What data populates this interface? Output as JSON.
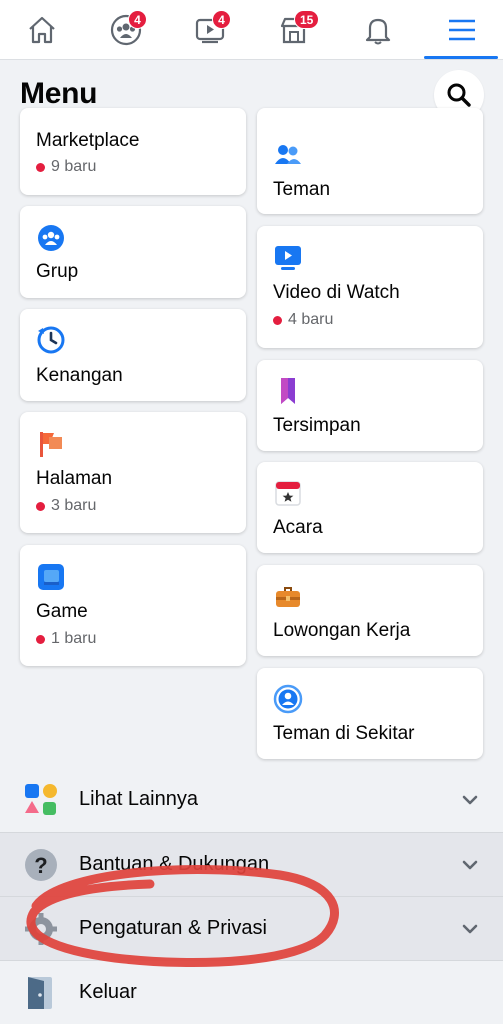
{
  "tabs": [
    {
      "name": "home-tab",
      "icon": "home-icon"
    },
    {
      "name": "groups-tab",
      "icon": "groups-icon",
      "badge": "4"
    },
    {
      "name": "watch-tab",
      "icon": "watch-icon",
      "badge": "4"
    },
    {
      "name": "marketplace-tab",
      "icon": "marketplace-icon",
      "badge": "15"
    },
    {
      "name": "notifications-tab",
      "icon": "bell-icon"
    },
    {
      "name": "menu-tab",
      "icon": "hamburger-icon",
      "active": true
    }
  ],
  "header": {
    "title": "Menu",
    "search_icon": "search-icon"
  },
  "left_cards": [
    {
      "label": "Marketplace",
      "sub": "9 baru",
      "icon": "marketplace-icon"
    },
    {
      "label": "Grup",
      "icon": "groups-icon"
    },
    {
      "label": "Kenangan",
      "icon": "memories-icon"
    },
    {
      "label": "Halaman",
      "sub": "3 baru",
      "icon": "pages-flag-icon"
    },
    {
      "label": "Game",
      "sub": "1 baru",
      "icon": "game-icon"
    }
  ],
  "right_cards": [
    {
      "label": "Teman",
      "icon": "friends-icon"
    },
    {
      "label": "Video di Watch",
      "sub": "4 baru",
      "icon": "watch-video-icon"
    },
    {
      "label": "Tersimpan",
      "icon": "bookmark-icon"
    },
    {
      "label": "Acara",
      "icon": "calendar-icon"
    },
    {
      "label": "Lowongan Kerja",
      "icon": "briefcase-icon"
    },
    {
      "label": "Teman di Sekitar",
      "icon": "nearby-friends-icon"
    }
  ],
  "rows": [
    {
      "label": "Lihat Lainnya",
      "icon": "see-more-shapes-icon"
    },
    {
      "label": "Bantuan & Dukungan",
      "icon": "help-icon"
    },
    {
      "label": "Pengaturan & Privasi",
      "icon": "settings-gear-icon"
    },
    {
      "label": "Keluar",
      "icon": "logout-door-icon"
    }
  ],
  "colors": {
    "accent": "#1877f2",
    "badge": "#e41e3f",
    "annotation": "#e0423b",
    "background": "#f0f2f5"
  }
}
